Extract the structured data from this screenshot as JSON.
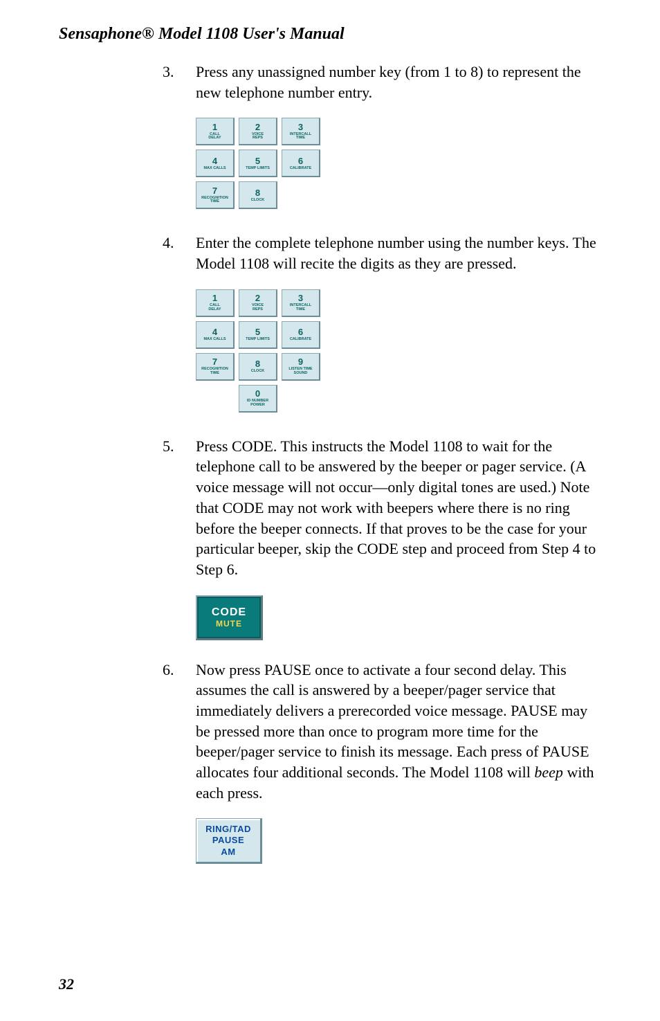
{
  "running_head": "Sensaphone® Model 1108 User's Manual",
  "page_number": "32",
  "steps": {
    "s3": {
      "num": "3.",
      "text": "Press any unassigned number key (from 1 to 8) to represent the new telephone number entry."
    },
    "s4": {
      "num": "4.",
      "text": "Enter the complete telephone number using the number keys. The Model 1108 will recite the digits as they are pressed."
    },
    "s5": {
      "num": "5.",
      "text": "Press CODE. This instructs the Model 1108 to wait for the telephone call to be answered by the beeper or pager service. (A voice message will not occur—only digital tones are used.) Note that CODE may not work with beepers where there is no ring before the beeper connects. If that proves to be the case for your particular beeper, skip the CODE step and proceed from Step 4 to Step 6."
    },
    "s6": {
      "num": "6.",
      "text_before_em": "Now press PAUSE once to activate a four second delay. This assumes the call is answered by a beeper/pager service that immediately delivers a prerecorded voice message. PAUSE may be pressed more than once to program more time for the beeper/pager service to finish its message. Each press of PAUSE allocates four additional seconds. The Model 1108 will ",
      "em": "beep",
      "text_after_em": " with each press."
    }
  },
  "keypad_labels": {
    "k1": {
      "num": "1",
      "lbl": "CALL\nDELAY"
    },
    "k2": {
      "num": "2",
      "lbl": "VOICE\nREPS"
    },
    "k3": {
      "num": "3",
      "lbl": "INTERCALL\nTIME"
    },
    "k4": {
      "num": "4",
      "lbl": "MAX CALLS"
    },
    "k5": {
      "num": "5",
      "lbl": "TEMP LIMITS"
    },
    "k6": {
      "num": "6",
      "lbl": "CALIBRATE"
    },
    "k7": {
      "num": "7",
      "lbl": "RECOGNITION\nTIME"
    },
    "k8": {
      "num": "8",
      "lbl": "CLOCK"
    },
    "k9": {
      "num": "9",
      "lbl": "LISTEN TIME\nSOUND"
    },
    "k0": {
      "num": "0",
      "lbl": "ID NUMBER\nPOWER"
    }
  },
  "code_button": {
    "line1": "CODE",
    "line2": "MUTE"
  },
  "ring_button": {
    "line1": "RING/TAD",
    "line2": "PAUSE",
    "line3": "AM"
  }
}
